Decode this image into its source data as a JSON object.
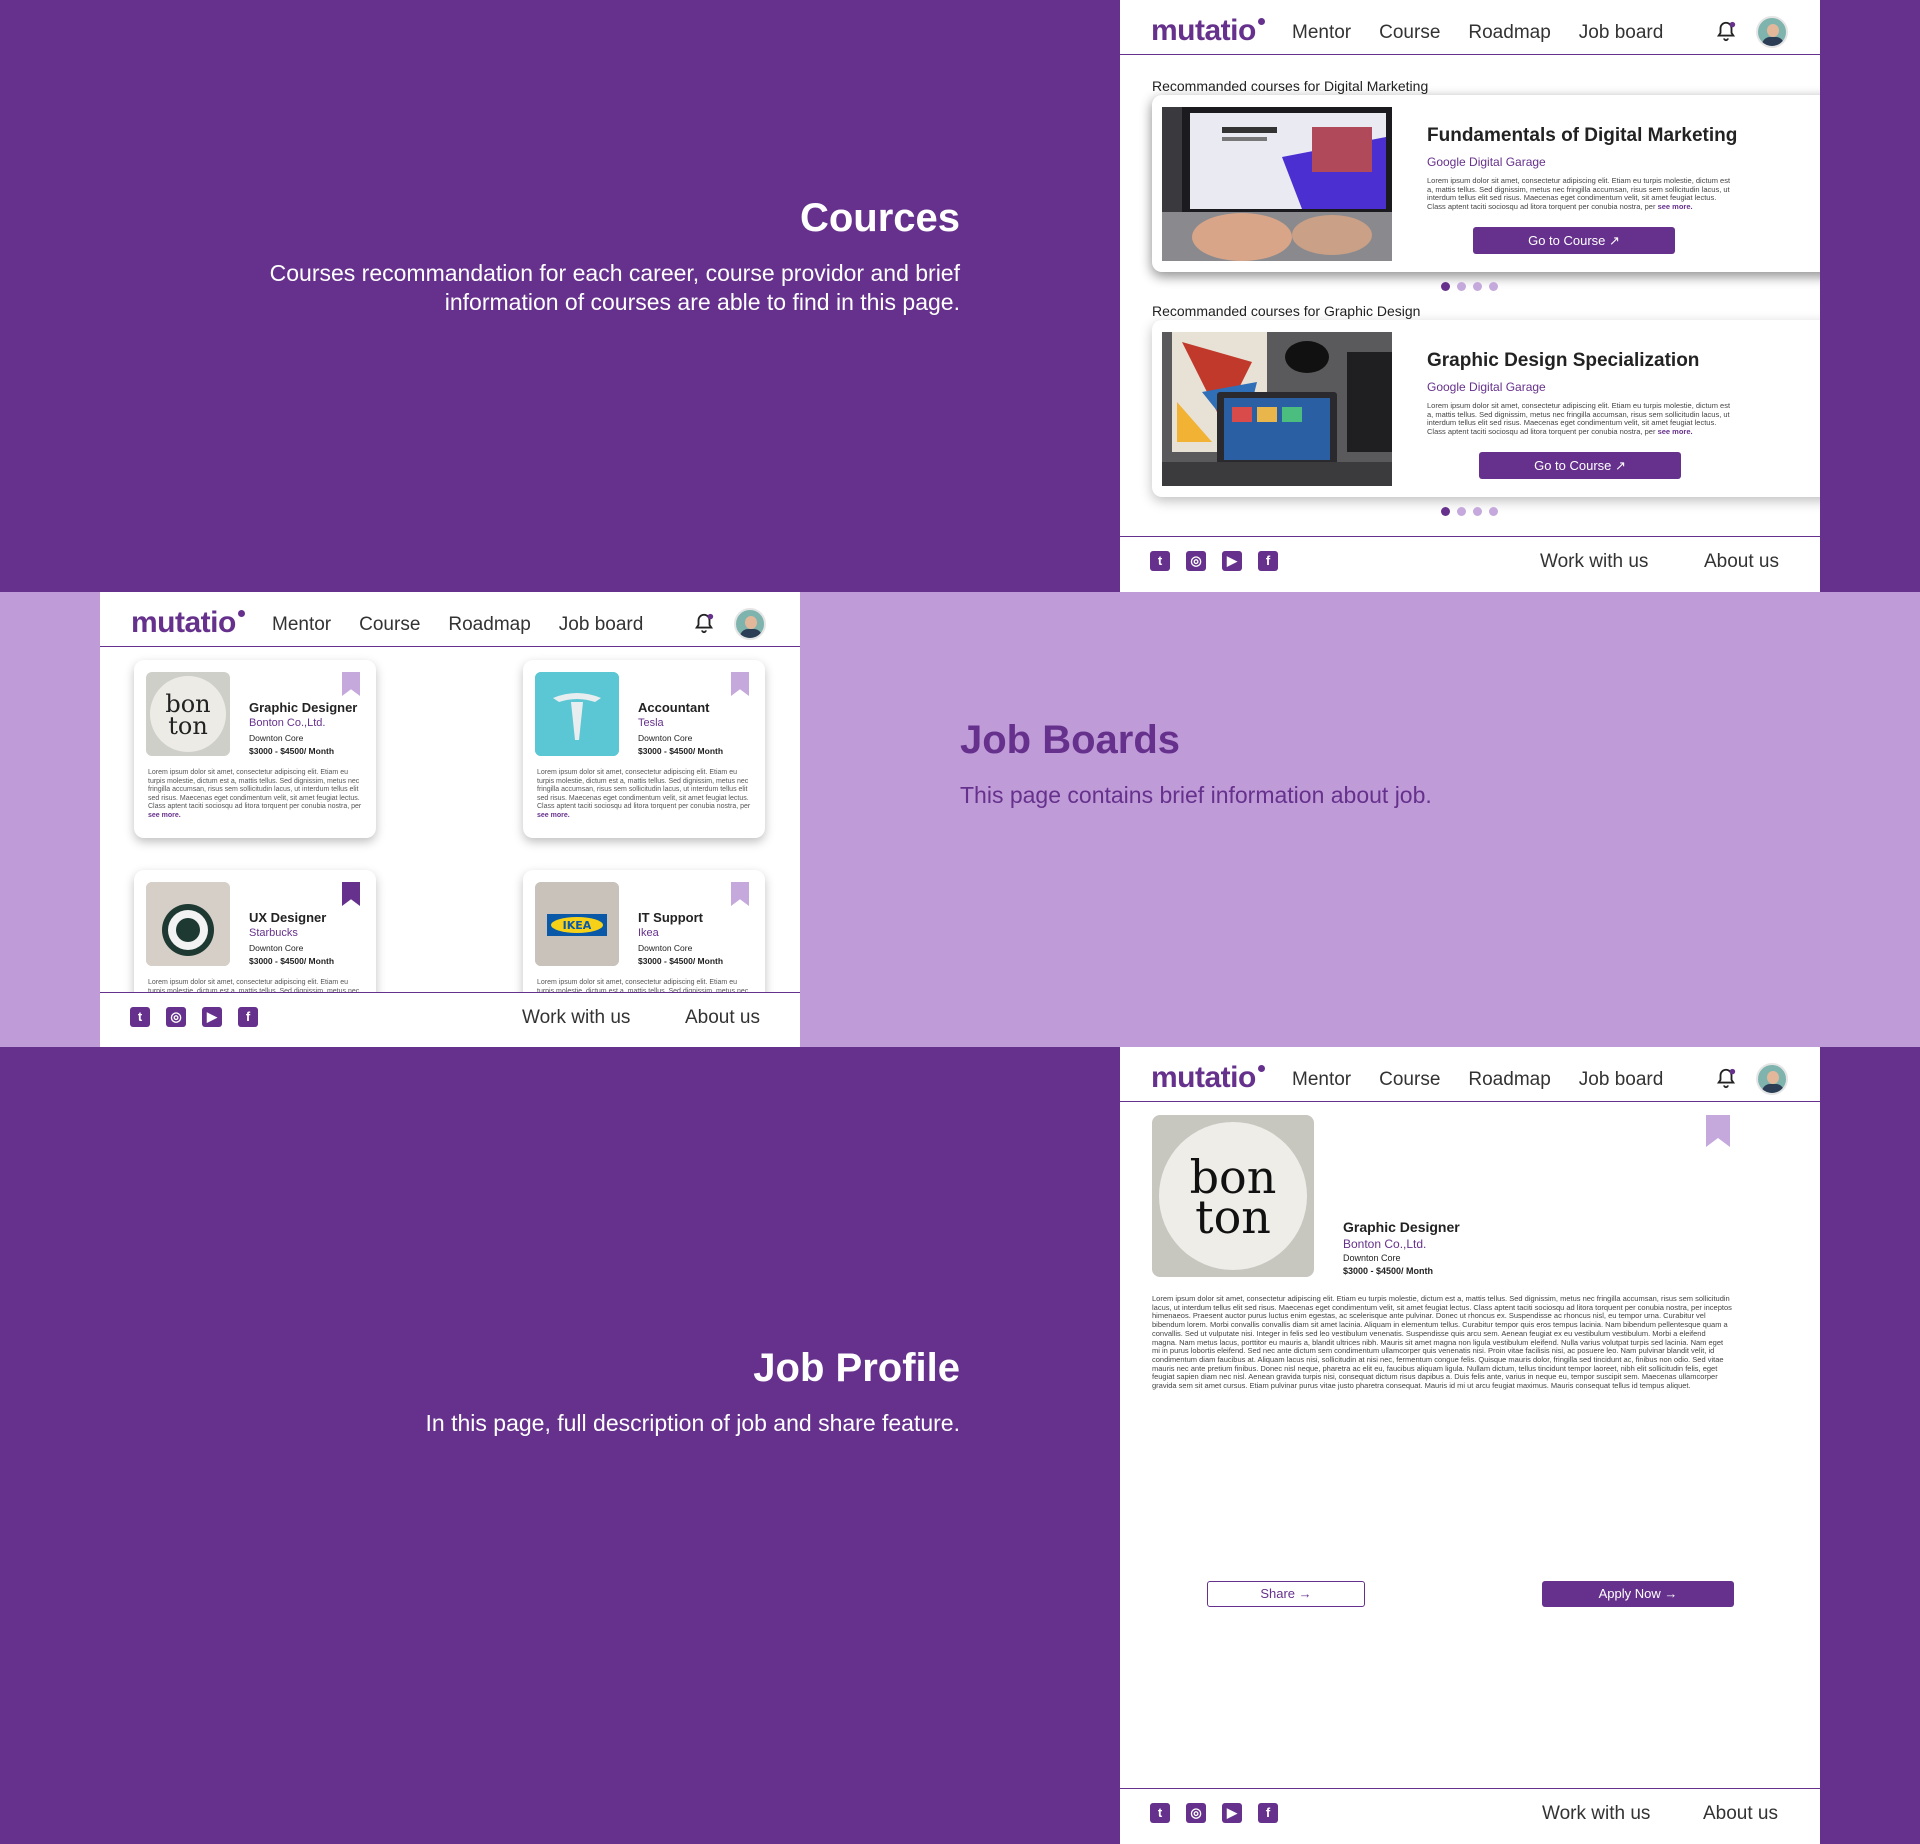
{
  "brand": {
    "logo": "mutatio",
    "accent": "#66318c",
    "light_accent": "#bf9bd8"
  },
  "nav": {
    "mentor": "Mentor",
    "course": "Course",
    "roadmap": "Roadmap",
    "job_board": "Job board"
  },
  "footer": {
    "work": "Work with us",
    "about": "About us",
    "icons": [
      "twitter-icon",
      "instagram-icon",
      "youtube-icon",
      "facebook-icon"
    ]
  },
  "lorem_short": "Lorem ipsum dolor sit amet, consectetur adipiscing elit. Etiam eu turpis molestie, dictum est a, mattis tellus. Sed dignissim, metus nec fringilla accumsan, risus sem sollicitudin lacus, ut interdum tellus elit sed risus. Maecenas eget condimentum velit, sit amet feugiat lectus. Class aptent taciti sociosqu ad litora torquent per conubia nostra, per",
  "see_more": "see more.",
  "courses_section": {
    "title": "Cources",
    "description": "Courses recommandation for each career, course providor and brief information of courses are able to find in this page.",
    "groups": [
      {
        "label": "Recommanded courses for Digital Marketing",
        "title": "Fundamentals of Digital Marketing",
        "provider": "Google Digital Garage",
        "button": "Go to Course ↗"
      },
      {
        "label": "Recommanded courses for Graphic Design",
        "title": "Graphic Design Specialization",
        "provider": "Google Digital Garage",
        "button": "Go to Course ↗"
      }
    ]
  },
  "jobs_section": {
    "title": "Job Boards",
    "description": "This page contains brief information about job.",
    "jobs": [
      {
        "title": "Graphic Designer",
        "company": "Bonton Co.,Ltd.",
        "location": "Downton Core",
        "salary": "$3000 - $4500/ Month",
        "logo_text": "bon ton"
      },
      {
        "title": "Accountant",
        "company": "Tesla",
        "location": "Downton Core",
        "salary": "$3000 - $4500/ Month",
        "logo_text": "T"
      },
      {
        "title": "UX Designer",
        "company": "Starbucks",
        "location": "Downton Core",
        "salary": "$3000 - $4500/ Month",
        "logo_text": ""
      },
      {
        "title": "IT Support",
        "company": "Ikea",
        "location": "Downton Core",
        "salary": "$3000 - $4500/ Month",
        "logo_text": "IKEA"
      }
    ]
  },
  "profile_section": {
    "title": "Job Profile",
    "description": "In this page, full description of job and share feature.",
    "job": {
      "title": "Graphic Designer",
      "company": "Bonton Co.,Ltd.",
      "location": "Downton Core",
      "salary": "$3000 - $4500/ Month",
      "logo_text": "bon ton"
    },
    "body": "Lorem ipsum dolor sit amet, consectetur adipiscing elit. Etiam eu turpis molestie, dictum est a, mattis tellus. Sed dignissim, metus nec fringilla accumsan, risus sem sollicitudin lacus, ut interdum tellus elit sed risus. Maecenas eget condimentum velit, sit amet feugiat lectus. Class aptent taciti sociosqu ad litora torquent per conubia nostra, per inceptos himenaeos. Praesent auctor purus luctus enim egestas, ac scelerisque ante pulvinar. Donec ut rhoncus ex. Suspendisse ac rhoncus nisl, eu tempor urna. Curabitur vel bibendum lorem. Morbi convallis convallis diam sit amet lacinia. Aliquam in elementum tellus. Curabitur tempor quis eros tempus lacinia. Nam bibendum pellentesque quam a convallis. Sed ut vulputate nisi. Integer in felis sed leo vestibulum venenatis. Suspendisse quis arcu sem. Aenean feugiat ex eu vestibulum vestibulum. Morbi a eleifend magna. Nam metus lacus, porttitor eu mauris a, blandit ultrices nibh. Mauris sit amet magna non ligula vestibulum eleifend. Nulla varius volutpat turpis sed lacinia. Nam eget mi in purus lobortis eleifend. Sed nec ante dictum sem condimentum ullamcorper quis venenatis nisi. Proin vitae facilisis nisi, ac posuere leo. Nam pulvinar blandit velit, id condimentum diam faucibus at. Aliquam lacus nisi, sollicitudin at nisi nec, fermentum congue felis. Quisque mauris dolor, fringilla sed tincidunt ac, finibus non odio. Sed vitae mauris nec ante pretium finibus. Donec nisl neque, pharetra ac elit eu, faucibus aliquam ligula. Nullam dictum, tellus tincidunt tempor laoreet, nibh elit sollicitudin felis, eget feugiat sapien diam nec nisl. Aenean gravida turpis nisi, consequat dictum risus dapibus a. Duis felis ante, varius in neque eu, tempor suscipit sem. Maecenas ullamcorper gravida sem sit amet cursus. Etiam pulvinar purus vitae justo pharetra consequat. Mauris id mi ut arcu feugiat maximus. Mauris consequat tellus id tempus aliquet.",
    "share": "Share →",
    "apply": "Apply Now →"
  }
}
